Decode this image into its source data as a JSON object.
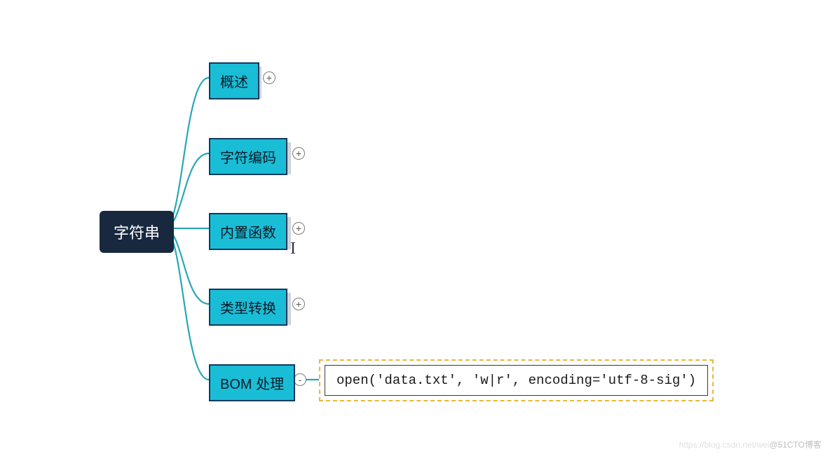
{
  "root": {
    "label": "字符串"
  },
  "children": [
    {
      "id": "overview",
      "label": "概述",
      "toggle": "+"
    },
    {
      "id": "encoding",
      "label": "字符编码",
      "toggle": "+"
    },
    {
      "id": "builtin",
      "label": "内置函数",
      "toggle": "+"
    },
    {
      "id": "typeconv",
      "label": "类型转换",
      "toggle": "+"
    },
    {
      "id": "bom",
      "label": "BOM 处理",
      "toggle": "-"
    }
  ],
  "leaf": {
    "code": "open('data.txt', 'w|r', encoding='utf-8-sig')"
  },
  "watermark": {
    "faint": "https://blog.csdn.net/wei",
    "text": "@51CTO博客"
  }
}
